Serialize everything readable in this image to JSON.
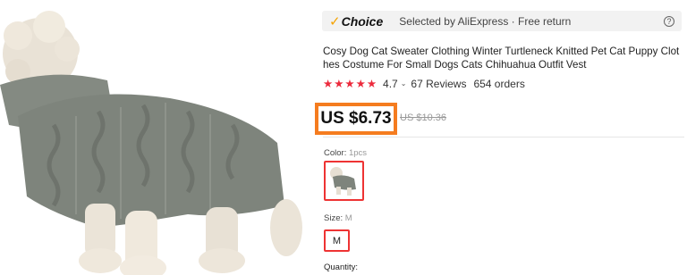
{
  "choice_bar": {
    "brand": "Choice",
    "text": "Selected by AliExpress · Free return",
    "help_icon": "question-circle-icon"
  },
  "product": {
    "title": "Cosy Dog Cat Sweater Clothing Winter Turtleneck Knitted Pet Cat Puppy Clothes Costume For Small Dogs Cats Chihuahua Outfit Vest",
    "rating": "4.7",
    "reviews": "67 Reviews",
    "orders": "654 orders",
    "price": "US $6.73",
    "original_price": "US $10.36",
    "color_label": "Color: ",
    "color_value": "1pcs",
    "size_label": "Size: ",
    "size_value": "M",
    "size_option": "M",
    "quantity_label": "Quantity:"
  },
  "colors": {
    "price_highlight": "#f57c1f",
    "star": "#ec2a3c",
    "selected_border": "#e33333",
    "sweater": "#7e847c"
  }
}
